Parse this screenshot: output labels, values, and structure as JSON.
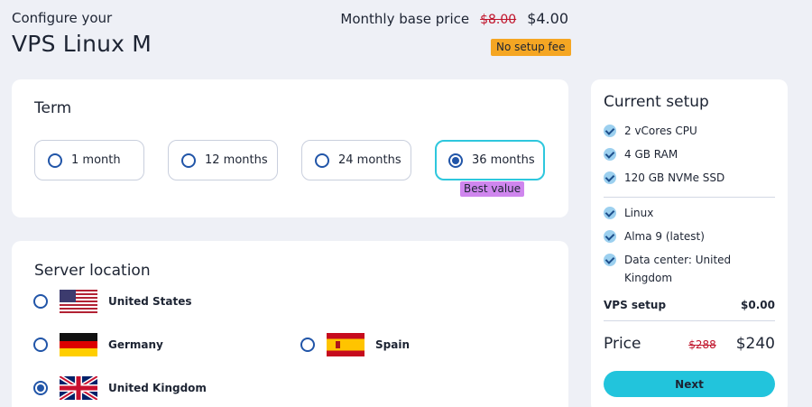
{
  "header": {
    "subtitle": "Configure your",
    "title": "VPS Linux M",
    "base_price_label": "Monthly base price",
    "base_price_old": "$8.00",
    "base_price_new": "$4.00",
    "no_setup_fee": "No setup fee"
  },
  "term": {
    "heading": "Term",
    "options": [
      {
        "label": "1 month",
        "selected": false
      },
      {
        "label": "12 months",
        "selected": false
      },
      {
        "label": "24 months",
        "selected": false
      },
      {
        "label": "36 months",
        "selected": true
      }
    ],
    "best_value_badge": "Best value"
  },
  "location": {
    "heading": "Server location",
    "options": [
      {
        "label": "United States",
        "flag": "us-flag-icon",
        "selected": false
      },
      {
        "label": "Germany",
        "flag": "de-flag-icon",
        "selected": false
      },
      {
        "label": "Spain",
        "flag": "es-flag-icon",
        "selected": false
      },
      {
        "label": "United Kingdom",
        "flag": "uk-flag-icon",
        "selected": true
      }
    ]
  },
  "summary": {
    "heading": "Current setup",
    "specs": [
      "2 vCores CPU",
      "4 GB RAM",
      "120 GB NVMe SSD"
    ],
    "config": [
      "Linux",
      "Alma 9 (latest)",
      "Data center: United Kingdom"
    ],
    "setup_label": "VPS setup",
    "setup_value": "$0.00",
    "price_label": "Price",
    "price_old": "$288",
    "price_new": "$240",
    "next_label": "Next"
  },
  "colors": {
    "accent": "#22c4dc",
    "radio": "#2155a8",
    "strike": "#c0142b",
    "badge_fee": "#f5a623",
    "badge_best": "#cf86ee",
    "background": "#eef0f6"
  }
}
